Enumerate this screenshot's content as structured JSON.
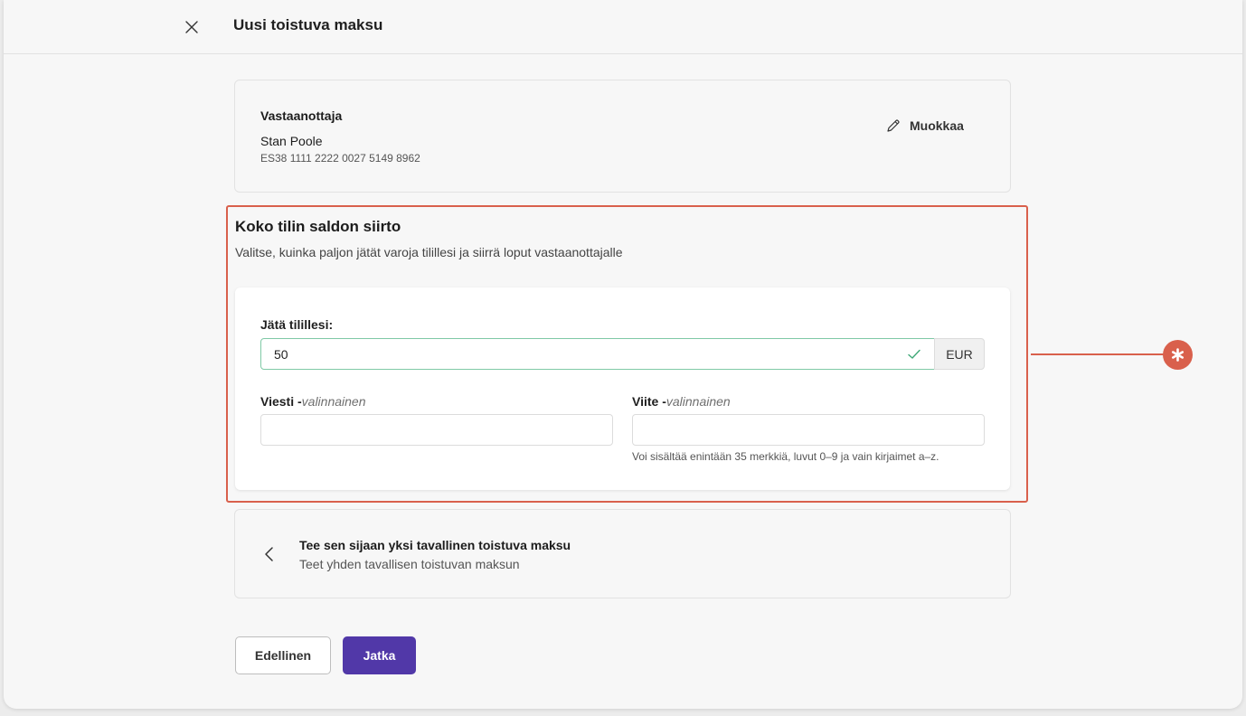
{
  "header": {
    "title": "Uusi toistuva maksu"
  },
  "recipient": {
    "heading": "Vastaanottaja",
    "name": "Stan Poole",
    "iban": "ES38 1111 2222 0027 5149 8962",
    "edit_label": "Muokkaa"
  },
  "transfer": {
    "title": "Koko tilin saldon siirto",
    "subtitle": "Valitse, kuinka paljon jätät varoja tilillesi ja siirrä loput vastaanottajalle",
    "amount_label": "Jätä tilillesi:",
    "amount_value": "50",
    "currency": "EUR",
    "message_label": "Viesti -",
    "message_optional": "valinnainen",
    "message_value": "",
    "reference_label": "Viite -",
    "reference_optional": "valinnainen",
    "reference_value": "",
    "reference_hint": "Voi sisältää enintään 35 merkkiä, luvut 0–9 ja vain kirjaimet a–z."
  },
  "alternative": {
    "title": "Tee sen sijaan yksi tavallinen toistuva maksu",
    "subtitle": "Teet yhden tavallisen toistuvan maksun"
  },
  "footer": {
    "prev_label": "Edellinen",
    "next_label": "Jatka"
  },
  "colors": {
    "primary": "#5138a8",
    "highlight": "#d9604c",
    "valid": "#3fa877"
  },
  "icons": {
    "close": "close-icon",
    "edit": "pencil-icon",
    "valid": "check-icon",
    "back": "chevron-left-icon",
    "marker": "asterisk-icon"
  }
}
